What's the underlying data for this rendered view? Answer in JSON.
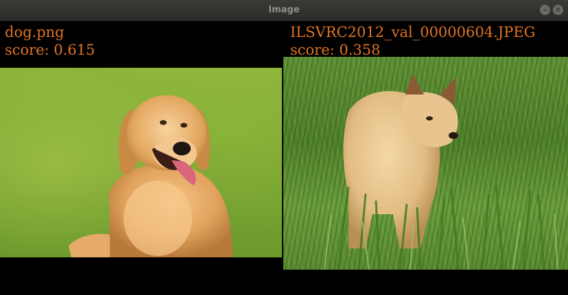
{
  "window": {
    "title": "Image",
    "minimize_glyph": "–",
    "close_glyph": "✕"
  },
  "images": [
    {
      "filename": "dog.png",
      "score": "score: 0.615"
    },
    {
      "filename": "ILSVRC2012_val_00000604.JPEG",
      "score": "score: 0.358"
    }
  ],
  "colors": {
    "caption_text": "#e07424",
    "canvas_background": "#000000",
    "titlebar": "#2b2b29"
  },
  "icons": [
    "minimize-icon",
    "close-icon"
  ]
}
